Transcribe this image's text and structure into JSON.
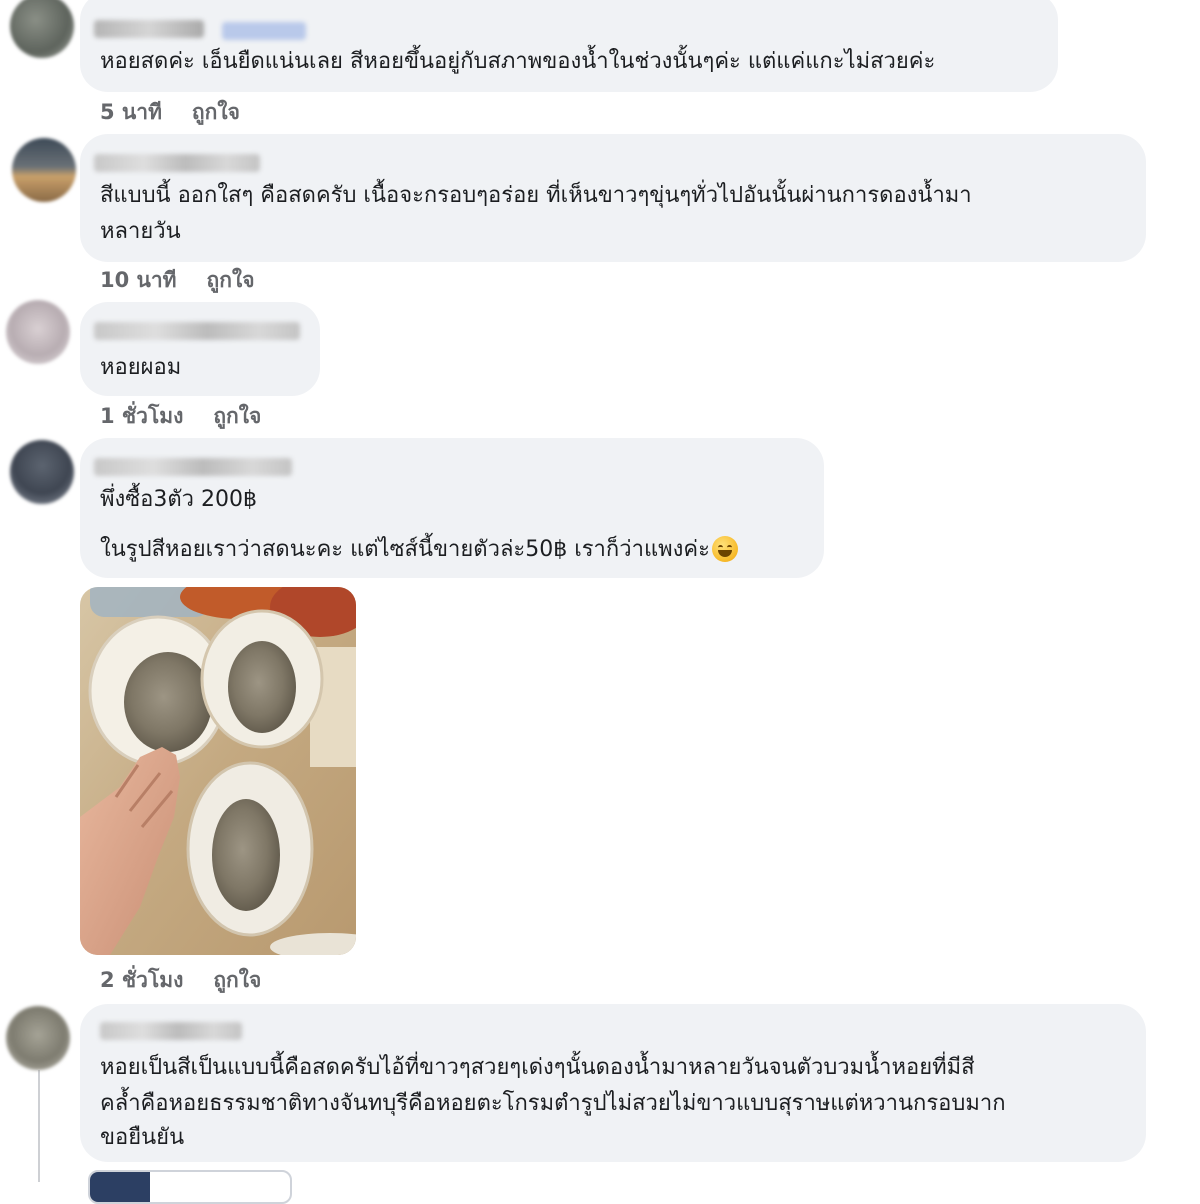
{
  "comments": [
    {
      "text_lines": [
        "หอยสดค่ะ เอ็นยืดแน่นเลย สีหอยขึ้นอยู่กับสภาพของน้ำในช่วงนั้นๆค่ะ แต่แค่แกะไม่สวยค่ะ"
      ],
      "time": "5 นาที",
      "like_label": "ถูกใจ"
    },
    {
      "text_lines": [
        "สีแบบนี้ ออกใสๆ คือสดครับ เนื้อจะกรอบๆอร่อย ที่เห็นขาวๆขุ่นๆทั่วไปอันนั้นผ่านการดองน้ำมา",
        "หลายวัน"
      ],
      "time": "10 นาที",
      "like_label": "ถูกใจ"
    },
    {
      "text_lines": [
        "หอยผอม"
      ],
      "time": "1 ชั่วโมง",
      "like_label": "ถูกใจ"
    },
    {
      "text_lines": [
        "พึ่งซื้อ3ตัว 200฿",
        "ในรูปสีหอยเราว่าสดนะคะ แต่ไซส์นี้ขายตัวล่ะ50฿ เราก็ว่าแพงค่ะ"
      ],
      "emoji": "grinning-sweat-emoji",
      "time": "2 ชั่วโมง",
      "like_label": "ถูกใจ"
    },
    {
      "text_lines": [
        "หอยเป็นสีเป็นแบบนี้คือสดครับไอ้ที่ขาวๆสวยๆเด่งๆนั้นดองน้ำมาหลายวันจนตัวบวมน้ำหอยที่มีสี",
        "คล้ำคือหอยธรรมชาติทางจันทบุรีคือหอยตะโกรมตำรูปไม่สวยไม่ขาวแบบสุราษแต่หวานกรอบมาก",
        "ขอยืนยัน"
      ]
    }
  ],
  "colors": {
    "bubble": "#f0f2f5",
    "meta_text": "#65676b",
    "body_text": "#1c1e21"
  },
  "icons": {
    "avatar": "blurred-profile-photo",
    "attachment": "oyster-photo"
  }
}
